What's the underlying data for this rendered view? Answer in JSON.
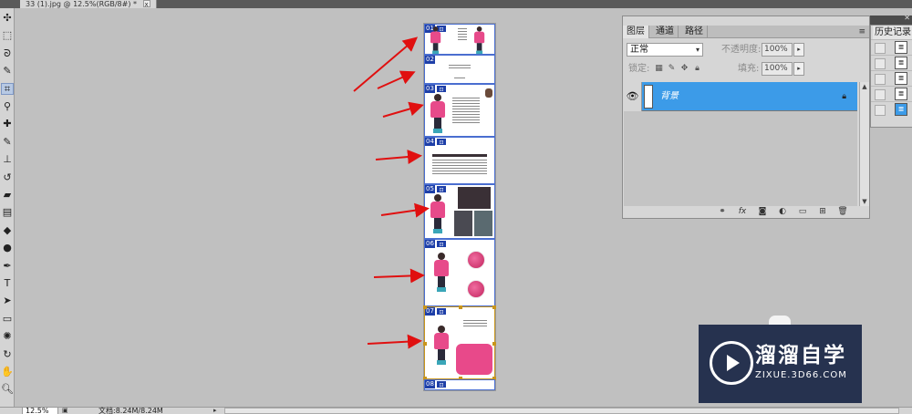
{
  "document": {
    "tab_title": "33 (1).jpg @ 12.5%(RGB/8#) *",
    "close_glyph": "x"
  },
  "tools": [
    {
      "name": "move-tool-icon",
      "glyph": "✣"
    },
    {
      "name": "marquee-tool-icon",
      "glyph": "⬚"
    },
    {
      "name": "lasso-tool-icon",
      "glyph": "ᘐ"
    },
    {
      "name": "quick-select-tool-icon",
      "glyph": "✎"
    },
    {
      "name": "crop-tool-icon",
      "glyph": "⌗"
    },
    {
      "name": "eyedropper-tool-icon",
      "glyph": "⚲"
    },
    {
      "name": "healing-brush-tool-icon",
      "glyph": "✚"
    },
    {
      "name": "brush-tool-icon",
      "glyph": "✎"
    },
    {
      "name": "clone-stamp-tool-icon",
      "glyph": "⊥"
    },
    {
      "name": "history-brush-tool-icon",
      "glyph": "↺"
    },
    {
      "name": "eraser-tool-icon",
      "glyph": "▰"
    },
    {
      "name": "gradient-tool-icon",
      "glyph": "▤"
    },
    {
      "name": "blur-tool-icon",
      "glyph": "◆"
    },
    {
      "name": "dodge-tool-icon",
      "glyph": "●"
    },
    {
      "name": "pen-tool-icon",
      "glyph": "✒"
    },
    {
      "name": "type-tool-icon",
      "glyph": "T"
    },
    {
      "name": "path-select-tool-icon",
      "glyph": "➤"
    },
    {
      "name": "shape-tool-icon",
      "glyph": "▭"
    },
    {
      "name": "3d-rotate-tool-icon",
      "glyph": "✺"
    },
    {
      "name": "3d-orbit-tool-icon",
      "glyph": "↻"
    },
    {
      "name": "hand-tool-icon",
      "glyph": "✋"
    },
    {
      "name": "zoom-tool-icon",
      "glyph": "🔍︎"
    }
  ],
  "slices": [
    {
      "num": "01"
    },
    {
      "num": "02"
    },
    {
      "num": "03"
    },
    {
      "num": "04"
    },
    {
      "num": "05"
    },
    {
      "num": "06"
    },
    {
      "num": "07"
    },
    {
      "num": "08"
    }
  ],
  "layers_panel": {
    "tabs": [
      "图层",
      "通道",
      "路径"
    ],
    "menu_glyph": "≡",
    "blend_mode": "正常",
    "opacity_label": "不透明度:",
    "opacity_value": "100%",
    "lock_label": "锁定:",
    "fill_label": "填充:",
    "fill_value": "100%",
    "layer_name": "背景",
    "arrow_glyph": "▸",
    "collapse_glyph": "◂◂",
    "close_glyph": "✕"
  },
  "history_panel": {
    "tab": "历史记录"
  },
  "status": {
    "zoom": "12.5%",
    "doc_info": "文档:8.24M/8.24M",
    "arrow": "▸"
  },
  "watermark": {
    "title": "溜溜自学",
    "subtitle": "ZIXUE.3D66.COM"
  },
  "colors": {
    "workspace": "#c0c0c0",
    "selected_layer": "#3c9be8",
    "slice_badge": "#1e3fa8",
    "arrow_red": "#e01010",
    "watermark_bg": "#26324f"
  }
}
